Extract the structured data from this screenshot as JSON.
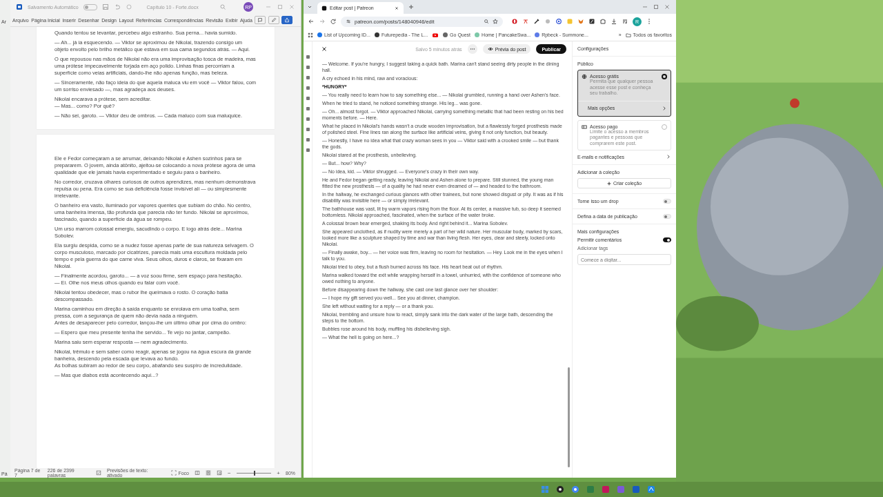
{
  "background_window": {
    "menu_text": "Ar",
    "status_text": "Pá"
  },
  "word": {
    "title": "Capítulo 10 - Forte.docx",
    "autosave_label": "Salvamento Automático",
    "autosave_on": false,
    "avatar": "RP",
    "ribbon_tabs": [
      "Arquivo",
      "Página Inicial",
      "Inserir",
      "Desenhar",
      "Design",
      "Layout",
      "Referências",
      "Correspondências",
      "Revisão",
      "Exibir",
      "Ajuda"
    ],
    "pages": [
      {
        "paragraphs": [
          "Quando tentou se levantar, percebeu algo estranho. Sua perna... havia sumido.",
          "— Ah... já ia esquecendo. — Viktor se aproximou de Nikolai, trazendo consigo um objeto envolto pelo brilho metálico que estava em sua cama segundos atrás. — Aqui.",
          "O que repousou nas mãos de Nikolai não era uma improvisação tosca de madeira, mas uma prótese impecavelmente forjada em aço polido. Linhas finas percorriam a superfície como veias artificiais, dando-lhe não apenas função, mas beleza.",
          "— Sinceramente, não faço ideia do que aquela maluca viu em você — Viktor falou, com um sorriso enviesado —, mas agradeça aos deuses.",
          "Nikolai encarava a prótese, sem acreditar.\n— Mas... como? Por quê?",
          "— Não sei, garoto. — Viktor deu de ombros. — Cada maluco com sua maluquice."
        ]
      },
      {
        "paragraphs": [
          "Ele e Fedor começaram a se arrumar, deixando Nikolai e Ashen sozinhos para se prepararem. O jovem, ainda atônito, ajeitou-se colocando a nova prótese agora de uma qualidade que ele jamais havia experimentado e seguiu para o banheiro.",
          "No corredor, cruzava olhares curiosos de outros aprendizes, mas nenhum demonstrava repulsa ou pena. Era como se sua deficiência fosse invisível ali — ou simplesmente irrelevante.",
          "O banheiro era vasto, iluminado por vapores quentes que subiam do chão. No centro, uma banheira imensa, tão profunda que parecia não ter fundo. Nikolai se aproximou, fascinado, quando a superfície da água se rompeu.",
          "Um urso marrom colossal emergiu, sacudindo o corpo. E logo atrás dele... Marina Sobolev.",
          "Ela surgiu despida, como se a nudez fosse apenas parte de sua natureza selvagem. O corpo musculoso, marcado por cicatrizes, parecia mais uma escultura moldada pelo tempo e pela guerra do que carne viva. Seus olhos, duros e claros, se fixaram em Nikolai.",
          "— Finalmente acordou, garoto... — a voz soou firme, sem espaço para hesitação.\n— Ei. Olhe nos meus olhos quando eu falar com você.",
          "Nikolai tentou obedecer, mas o rubor lhe queimava o rosto. O coração batia descompassado.",
          "Marina caminhou em direção à saída enquanto se enrolava em uma toalha, sem pressa, com a segurança de quem não devia nada a ninguém.\nAntes de desaparecer pelo corredor, lançou-lhe um último olhar por cima do ombro:",
          "— Espero que meu presente tenha lhe servido... Te vejo no jantar, campeão.",
          "Marina saiu sem esperar resposta — nem agradecimento.",
          "Nikolai, trêmulo e sem saber como reagir, apenas se jogou na água escura da grande banheira, descendo pela escada que levava ao fundo.\nAs bolhas subiram ao redor de seu corpo, abafando seu suspiro de incredulidade.",
          "— Mas que diabos está acontecendo aqui...?"
        ]
      }
    ],
    "status": {
      "page": "Página 7 de 7",
      "words": "226 de 2399 palavras",
      "predictions": "Previsões de texto: ativado",
      "focus": "Foco",
      "zoom_out": "−",
      "zoom_in": "+",
      "zoom": "80%"
    },
    "zoom_slider": {
      "level": 0.5
    }
  },
  "browser": {
    "tab_title": "Editar post | Patreon",
    "url": "patreon.com/posts/148040946/edit",
    "avatar": "R",
    "bookmarks": [
      {
        "kind": "site",
        "label": "List of Upcoming ID..."
      },
      {
        "kind": "site",
        "label": "Futurepedia - The L..."
      },
      {
        "kind": "video"
      },
      {
        "kind": "site",
        "label": "Go Quest"
      },
      {
        "kind": "site",
        "label": "Home | PancakeSwa..."
      },
      {
        "kind": "site",
        "label": "Rpbeck - Summone..."
      }
    ],
    "more_bookmarks": "»",
    "all_bookmarks": "Todos os favoritos"
  },
  "editor": {
    "saved": "Salvo 5 minutos atrás",
    "preview": "Prévia do post",
    "publish": "Publicar",
    "paragraphs": [
      {
        "kind": "plain",
        "text": "— Welcome. If you're hungry, I suggest taking a quick bath. Marina can't stand seeing dirty people in the dining hall."
      },
      {
        "kind": "plain",
        "text": "A cry echoed in his mind, raw and voracious:"
      },
      {
        "kind": "bold",
        "text": "*HUNGRY*"
      },
      {
        "kind": "plain",
        "text": "— You really need to learn how to say something else... — Nikolai grumbled, running a hand over Ashen's face."
      },
      {
        "kind": "plain",
        "text": "When he tried to stand, he noticed something strange. His leg... was gone."
      },
      {
        "kind": "plain",
        "text": "— Oh... almost forgot. — Viktor approached Nikolai, carrying something metallic that had been resting on his bed moments before. — Here."
      },
      {
        "kind": "plain",
        "text": "What he placed in Nikolai's hands wasn't a crude wooden improvisation, but a flawlessly forged prosthesis made of polished steel. Fine lines ran along the surface like artificial veins, giving it not only function, but beauty."
      },
      {
        "kind": "plain",
        "text": "— Honestly, I have no idea what that crazy woman sees in you — Viktor said with a crooked smile — but thank the gods."
      },
      {
        "kind": "plain",
        "text": "Nikolai stared at the prosthesis, unbelieving."
      },
      {
        "kind": "plain",
        "text": "— But... how? Why?"
      },
      {
        "kind": "plain",
        "text": "— No idea, kid. — Viktor shrugged. — Everyone's crazy in their own way."
      },
      {
        "kind": "plain",
        "text": "He and Fedor began getting ready, leaving Nikolai and Ashen alone to prepare. Still stunned, the young man fitted the new prosthesis — of a quality he had never even dreamed of — and headed to the bathroom."
      },
      {
        "kind": "plain",
        "text": "In the hallway, he exchanged curious glances with other trainees, but none showed disgust or pity. It was as if his disability was invisible here — or simply irrelevant."
      },
      {
        "kind": "plain",
        "text": "The bathhouse was vast, lit by warm vapors rising from the floor. At its center, a massive tub, so deep it seemed bottomless. Nikolai approached, fascinated, when the surface of the water broke."
      },
      {
        "kind": "plain",
        "text": "A colossal brown bear emerged, shaking its body. And right behind it... Marina Sobolev."
      },
      {
        "kind": "plain",
        "text": "She appeared unclothed, as if nudity were merely a part of her wild nature. Her muscular body, marked by scars, looked more like a sculpture shaped by time and war than living flesh. Her eyes, clear and steely, locked onto Nikolai."
      },
      {
        "kind": "plain",
        "text": "— Finally awake, boy... — her voice was firm, leaving no room for hesitation. — Hey. Look me in the eyes when I talk to you."
      },
      {
        "kind": "plain",
        "text": "Nikolai tried to obey, but a flush burned across his face. His heart beat out of rhythm."
      },
      {
        "kind": "plain",
        "text": "Marina walked toward the exit while wrapping herself in a towel, unhurried, with the confidence of someone who owed nothing to anyone."
      },
      {
        "kind": "plain",
        "text": "Before disappearing down the hallway, she cast one last glance over her shoulder:"
      },
      {
        "kind": "plain",
        "text": "— I hope my gift served you well... See you at dinner, champion."
      },
      {
        "kind": "plain",
        "text": "She left without waiting for a reply — or a thank you."
      },
      {
        "kind": "plain",
        "text": "Nikolai, trembling and unsure how to react, simply sank into the dark water of the large bath, descending the steps to the bottom."
      },
      {
        "kind": "plain",
        "text": "Bubbles rose around his body, muffling his disbelieving sigh."
      },
      {
        "kind": "plain",
        "text": "— What the hell is going on here...?"
      }
    ]
  },
  "settings": {
    "title": "Configurações",
    "audience_heading": "Público",
    "options": [
      {
        "kind": "free",
        "title": "Acesso grátis",
        "description": "Permita que qualquer pessoa acesse esse post e conheça seu trabalho.",
        "selected": true
      },
      {
        "kind": "paid",
        "title": "Acesso pago",
        "description": "Limite o acesso a membros pagantes e pessoas que comprarem este post.",
        "selected": false
      }
    ],
    "more_options": "Mais opções",
    "emails": "E-mails e notificações",
    "collection_heading": "Adicionar à coleção",
    "create_collection": "Criar coleção",
    "toggles": [
      {
        "label": "Torne isso um drop",
        "on": false
      },
      {
        "label": "Defina a data de publicação",
        "on": false
      }
    ],
    "more_settings_heading": "Mais configurações",
    "comments": {
      "label": "Permitir comentários",
      "on": true
    },
    "tags_label": "Adicionar tags",
    "tags_placeholder": "Comece a digitar..."
  }
}
